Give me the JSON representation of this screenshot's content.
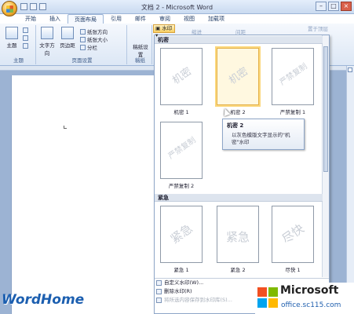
{
  "window": {
    "title": "文档 2 - Microsoft Word",
    "controls": [
      "–",
      "□",
      "×"
    ]
  },
  "ribbon_tabs": [
    "开始",
    "插入",
    "页面布局",
    "引用",
    "邮件",
    "审阅",
    "视图",
    "加载项"
  ],
  "ribbon": {
    "theme_group": {
      "label": "主题",
      "theme_button": "主题"
    },
    "page_setup_group": {
      "label": "页面设置",
      "text_direction": "文字方向",
      "margins": "页边距",
      "orientation": "纸张方向",
      "size": "纸张大小",
      "columns": "分栏"
    },
    "draft_group": {
      "label": "稿纸",
      "draft_button": "稿纸设置"
    },
    "watermark_button": "水印",
    "indent_label": "缩进",
    "spacing_label": "间距",
    "position_label": "置于顶层"
  },
  "gallery": {
    "sections": [
      {
        "title": "机密",
        "items": [
          {
            "watermark": "机密",
            "label": "机密 1"
          },
          {
            "watermark": "机密",
            "label": "机密 2"
          },
          {
            "watermark": "严禁复制",
            "label": "严禁复制 1"
          },
          {
            "watermark": "严禁复制",
            "label": "严禁复制 2"
          }
        ]
      },
      {
        "title": "紧急",
        "items": [
          {
            "watermark": "紧急",
            "label": "紧急 1"
          },
          {
            "watermark": "紧急",
            "label": "紧急 2"
          },
          {
            "watermark": "尽快",
            "label": "尽快 1"
          }
        ]
      }
    ],
    "menu": [
      {
        "label": "自定义水印(W)...",
        "disabled": false
      },
      {
        "label": "删除水印(R)",
        "disabled": false
      },
      {
        "label": "将所选内容保存到水印库(S)...",
        "disabled": true
      }
    ]
  },
  "tooltip": {
    "title": "机密 2",
    "body": "以灰色模版文字显示的\"机密\"水印"
  },
  "branding": {
    "site_logo": "WordHome",
    "ms_name": "Microsoft",
    "ms_site": "office.sc115.com",
    "ms_colors": [
      "#f25022",
      "#7fba00",
      "#00a4ef",
      "#ffb900"
    ]
  }
}
